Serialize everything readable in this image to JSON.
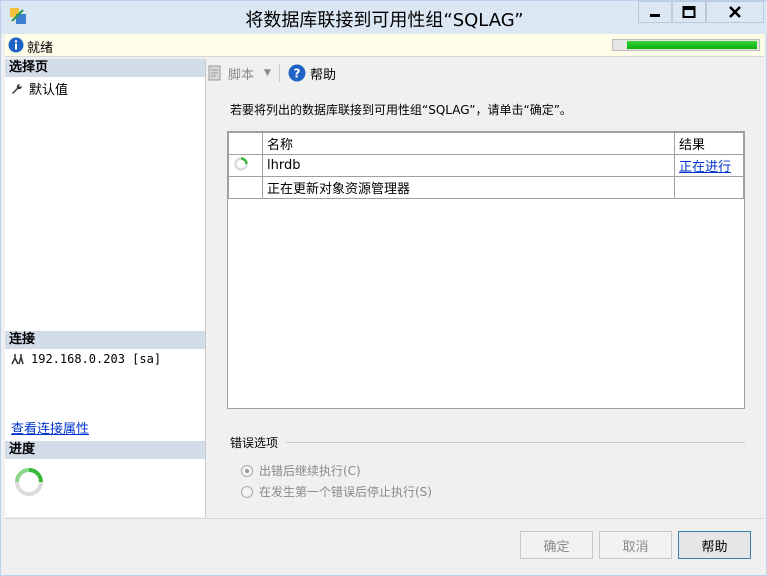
{
  "window": {
    "title": "将数据库联接到可用性组“SQLAG”",
    "controls": [
      "minimize",
      "maximize",
      "close"
    ]
  },
  "status": {
    "text": "就绪",
    "progress": 0.9
  },
  "left": {
    "select_page_header": "选择页",
    "select_page_items": [
      {
        "label": "默认值",
        "icon": "wrench-icon"
      }
    ],
    "connection_header": "连接",
    "connection_value": "192.168.0.203 [sa]",
    "connection_link": "查看连接属性",
    "progress_header": "进度"
  },
  "toolbar": {
    "script_label": "脚本",
    "help_label": "帮助"
  },
  "main": {
    "instruction": "若要将列出的数据库联接到可用性组“SQLAG”，请单击“确定”。",
    "columns": [
      "名称",
      "结果"
    ],
    "rows": [
      {
        "icon": "spinner-icon",
        "name": "lhrdb",
        "result": "正在进行"
      },
      {
        "icon": "",
        "name": "正在更新对象资源管理器",
        "result": ""
      }
    ]
  },
  "error_options": {
    "header": "错误选项",
    "options": [
      {
        "label": "出错后继续执行(C)",
        "selected": true
      },
      {
        "label": "在发生第一个错误后停止执行(S)",
        "selected": false
      }
    ]
  },
  "buttons": {
    "ok": "确定",
    "cancel": "取消",
    "help": "帮助"
  },
  "colors": {
    "progress_green": "#16c016",
    "link_blue": "#0033cc",
    "section_header_bg": "#d3dce9"
  }
}
